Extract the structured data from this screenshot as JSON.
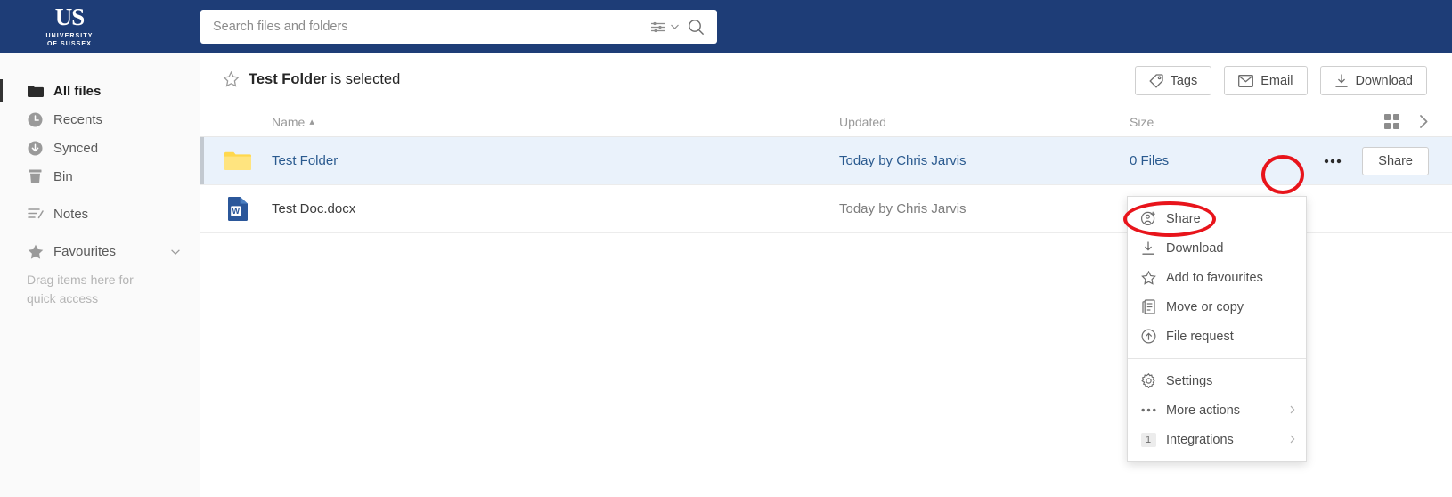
{
  "brand": {
    "logo_mark": "US",
    "logo_line1": "UNIVERSITY",
    "logo_line2": "OF SUSSEX",
    "bar_color": "#1e3d77"
  },
  "search": {
    "placeholder": "Search files and folders",
    "value": "",
    "filter_icon": "sliders-icon",
    "chevron_icon": "chevron-down-icon",
    "search_icon": "search-icon"
  },
  "sidebar": {
    "items": [
      {
        "label": "All files",
        "icon": "folder-icon",
        "active": true
      },
      {
        "label": "Recents",
        "icon": "clock-icon",
        "active": false
      },
      {
        "label": "Synced",
        "icon": "sync-down-icon",
        "active": false
      },
      {
        "label": "Bin",
        "icon": "trash-icon",
        "active": false
      },
      {
        "label": "Notes",
        "icon": "notes-icon",
        "active": false
      },
      {
        "label": "Favourites",
        "icon": "star-icon",
        "active": false
      }
    ],
    "favourites_hint": "Drag items here for quick access"
  },
  "header": {
    "selection_name": "Test Folder",
    "selection_suffix": " is selected",
    "star_icon": "star-outline-icon",
    "actions": [
      {
        "label": "Tags",
        "icon": "tag-icon"
      },
      {
        "label": "Email",
        "icon": "envelope-icon"
      },
      {
        "label": "Download",
        "icon": "download-icon"
      }
    ]
  },
  "table": {
    "columns": {
      "name": "Name",
      "sort_indicator": "▴",
      "updated": "Updated",
      "size": "Size"
    },
    "view_tools": [
      {
        "name": "grid-view-icon"
      },
      {
        "name": "chevron-right-icon"
      }
    ],
    "rows": [
      {
        "name": "Test Folder",
        "icon": "folder-yellow-icon",
        "updated": "Today by Chris Jarvis",
        "size": "0 Files",
        "selected": true,
        "share_label": "Share",
        "more_icon": "ellipsis-icon"
      },
      {
        "name": "Test Doc.docx",
        "icon": "word-doc-icon",
        "updated": "Today by Chris Jarvis",
        "size": "",
        "selected": false,
        "share_label": "",
        "more_icon": ""
      }
    ]
  },
  "context_menu": {
    "group1": [
      {
        "label": "Share",
        "icon": "person-add-icon",
        "submenu": false,
        "badge": ""
      },
      {
        "label": "Download",
        "icon": "download-icon",
        "submenu": false,
        "badge": ""
      },
      {
        "label": "Add to favourites",
        "icon": "star-outline-icon",
        "submenu": false,
        "badge": ""
      },
      {
        "label": "Move or copy",
        "icon": "copy-icon",
        "submenu": false,
        "badge": ""
      },
      {
        "label": "File request",
        "icon": "upload-circle-icon",
        "submenu": false,
        "badge": ""
      }
    ],
    "group2": [
      {
        "label": "Settings",
        "icon": "gear-icon",
        "submenu": false,
        "badge": ""
      },
      {
        "label": "More actions",
        "icon": "ellipsis-icon",
        "submenu": true,
        "badge": ""
      },
      {
        "label": "Integrations",
        "icon": "count-badge",
        "submenu": true,
        "badge": "1"
      }
    ]
  },
  "annotations": {
    "color": "#e8141b",
    "marks": [
      {
        "name": "ellipse-around-more-button"
      },
      {
        "name": "ellipse-around-share-menu-item"
      }
    ]
  }
}
